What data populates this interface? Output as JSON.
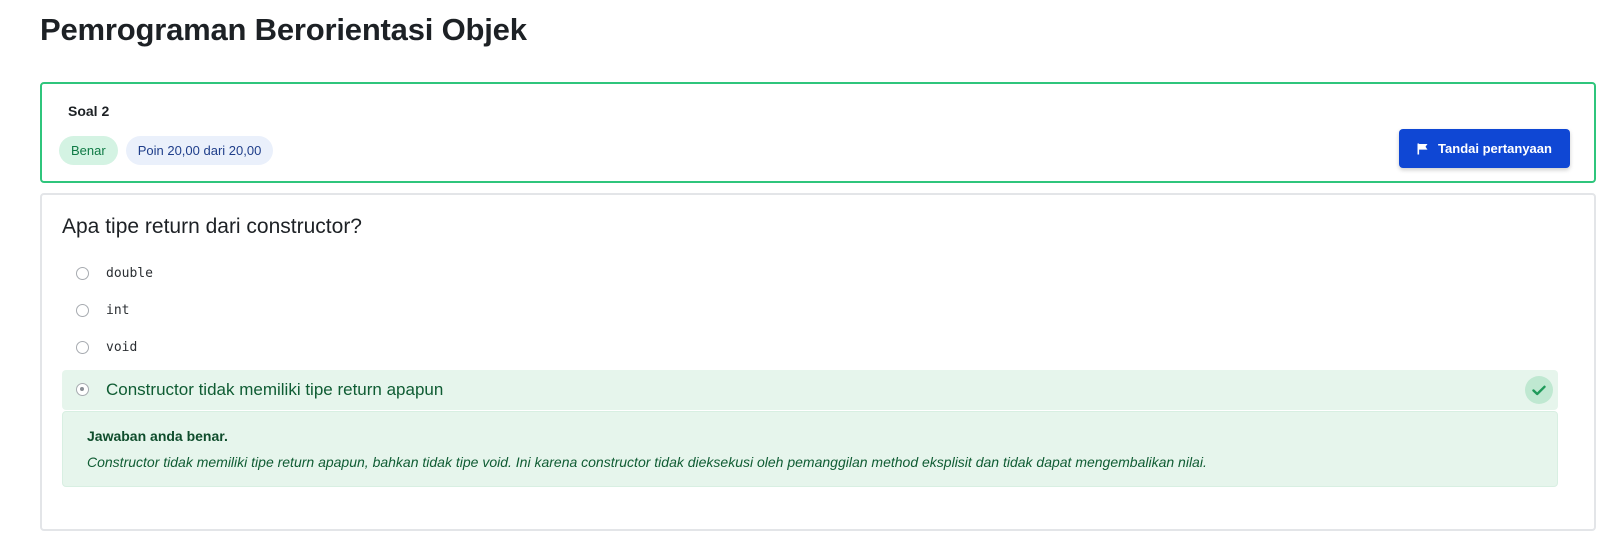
{
  "page": {
    "title": "Pemrograman Berorientasi Objek"
  },
  "question_info": {
    "number_label": "Soal 2",
    "status_badge": "Benar",
    "points_badge": "Poin 20,00 dari 20,00",
    "flag_button_label": "Tandai pertanyaan",
    "flag_icon": "flag-icon"
  },
  "question": {
    "text": "Apa tipe return dari constructor?",
    "options": [
      {
        "label": "double",
        "selected": false
      },
      {
        "label": "int",
        "selected": false
      },
      {
        "label": "void",
        "selected": false
      },
      {
        "label": "Constructor tidak memiliki tipe return apapun",
        "selected": true,
        "correct": true
      }
    ],
    "correct_icon": "check-icon"
  },
  "feedback": {
    "title": "Jawaban anda benar.",
    "text": "Constructor tidak memiliki tipe return apapun, bahkan tidak tipe void. Ini karena constructor tidak dieksekusi oleh pemanggilan method eksplisit dan tidak dapat mengembalikan nilai."
  },
  "colors": {
    "accent_blue": "#0f47d4",
    "correct_green": "#2fc57c",
    "correct_bg": "#e6f5ec"
  }
}
